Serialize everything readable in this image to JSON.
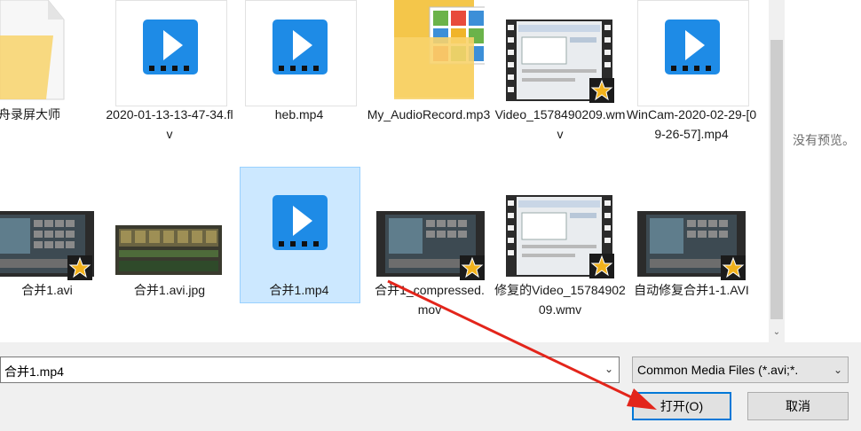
{
  "files": [
    {
      "label": "金舟录屏大师",
      "kind": "folder"
    },
    {
      "label": "2020-01-13-13-47-34.flv",
      "kind": "video-icon"
    },
    {
      "label": "heb.mp4",
      "kind": "video-icon"
    },
    {
      "label": "My_AudioRecord.mp3",
      "kind": "photo-folder"
    },
    {
      "label": "Video_1578490209.wmv",
      "kind": "film-thumb"
    },
    {
      "label": "WinCam-2020-02-29-[09-26-57].mp4",
      "kind": "video-icon"
    },
    {
      "label": "合并1.avi",
      "kind": "film-thumb"
    },
    {
      "label": "合并1.avi.jpg",
      "kind": "image-thumb"
    },
    {
      "label": "合并1.mp4",
      "kind": "video-icon",
      "selected": true
    },
    {
      "label": "合并1_compressed.mov",
      "kind": "film-thumb"
    },
    {
      "label": "修复的Video_1578490209.wmv",
      "kind": "film-thumb"
    },
    {
      "label": "自动修复合并1-1.AVI",
      "kind": "film-thumb"
    }
  ],
  "preview": {
    "empty_text": "没有预览。"
  },
  "footer": {
    "filename_value": "合并1.mp4",
    "filter_value": "Common Media Files (*.avi;*.",
    "open_label": "打开(O)",
    "cancel_label": "取消"
  },
  "colors": {
    "accent": "#0078d7",
    "selection": "#cce8ff",
    "play_icon": "#1e8be6",
    "arrow": "#e3251b"
  }
}
